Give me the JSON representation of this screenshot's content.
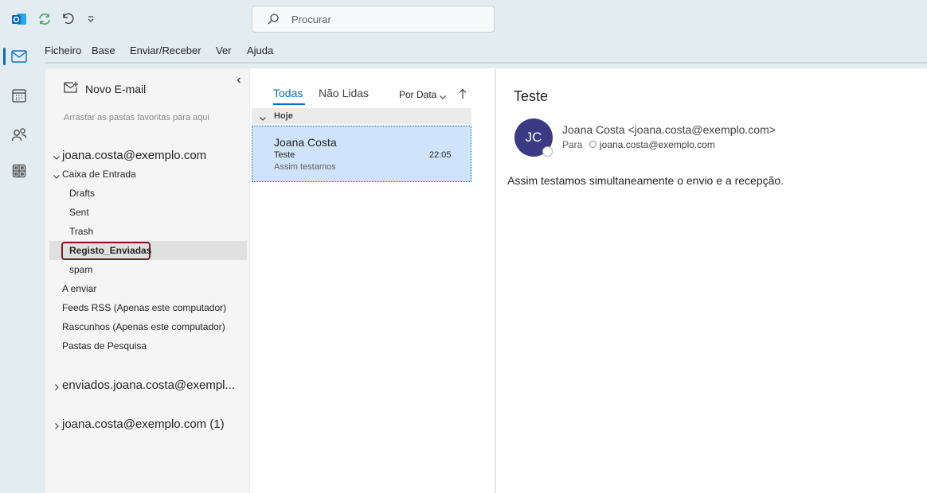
{
  "search": {
    "placeholder": "Procurar"
  },
  "menu": [
    "Ficheiro",
    "Base",
    "Enviar/Receber",
    "Ver",
    "Ajuda"
  ],
  "folder_pane": {
    "new_mail": "Novo E-mail",
    "favorites_hint": "Arrastar as pastas favoritas para aqui",
    "account": "joana.costa@exemplo.com",
    "inbox": "Caixa de Entrada",
    "subfolders": [
      "Drafts",
      "Sent",
      "Trash",
      "Registo_Enviadas",
      "spam"
    ],
    "folders": [
      "A enviar",
      "Feeds RSS (Apenas este computador)",
      "Rascunhos (Apenas este computador)",
      "Pastas de Pesquisa"
    ],
    "account2": "enviados.joana.costa@exempl...",
    "account3": "joana.costa@exemplo.com (1)"
  },
  "message_list": {
    "tab_all": "Todas",
    "tab_unread": "Não Lidas",
    "sort": "Por Data",
    "group": "Hoje",
    "item": {
      "sender": "Joana Costa",
      "subject": "Teste",
      "time": "22:05",
      "preview": "Assim testamos"
    }
  },
  "reading_pane": {
    "subject": "Teste",
    "avatar_initials": "JC",
    "from": "Joana Costa <joana.costa@exemplo.com>",
    "to_label": "Para",
    "to": "joana.costa@exemplo.com",
    "body": "Assim testamos simultaneamente o envio e a recepção."
  },
  "colors": {
    "accent": "#0f6cbd",
    "selected_item": "#cfe4fa",
    "avatar": "#3b3a84",
    "highlight_border": "#7a1a2a"
  }
}
